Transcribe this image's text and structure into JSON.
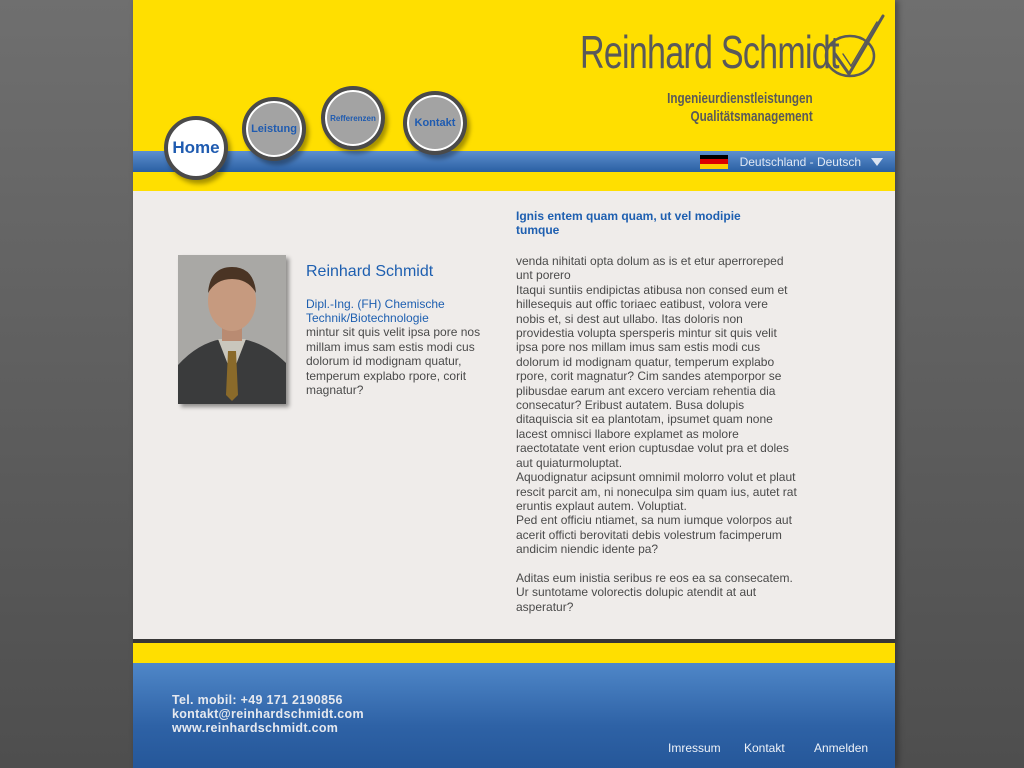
{
  "logo": {
    "name": "Reinhard Schmidt",
    "subtitle_1": "Ingenieurdienstleistungen",
    "subtitle_2": "Qualitätsmanagement"
  },
  "nav": {
    "home": "Home",
    "leistung": "Leistung",
    "referenzen": "Refferenzen",
    "kontakt": "Kontakt"
  },
  "language": {
    "selected": "Deutschland - Deutsch"
  },
  "profile": {
    "name": "Reinhard Schmidt",
    "title": "Dipl.-Ing. (FH) Chemische Technik/Biotechnologie",
    "text": "mintur sit quis velit ipsa pore nos millam imus sam estis modi cus dolorum id modignam quatur, temperum explabo rpore, corit magnatur?"
  },
  "article": {
    "heading": "Ignis entem quam quam, ut vel modipie tumque",
    "paragraphs": [
      "venda nihitati opta dolum as is et etur aperroreped unt porero",
      "Itaqui suntiis endipictas atibusa non consed eum et hillesequis aut offic toriaec eatibust, volora vere nobis et, si dest aut ullabo. Itas doloris non providestia volupta spersperis mintur sit quis velit ipsa pore nos millam imus sam estis modi cus dolorum id modignam quatur, temperum explabo rpore, corit magnatur? Cim sandes atemporpor se plibusdae earum ant excero verciam rehentia dia consecatur? Eribust autatem. Busa dolupis ditaquiscia sit ea plantotam, ipsumet quam none lacest omnisci llabore explamet as molore raectotatate vent erion cuptusdae volut pra et doles aut quiaturmoluptat.",
      "Aquodignatur acipsunt omnimil molorro volut et plaut rescit parcit am, ni noneculpa sim quam ius, autet rat eruntis explaut autem. Voluptiat.",
      "Ped ent officiu ntiamet, sa num iumque volorpos aut acerit officti berovitati debis volestrum facimperum andicim niendic idente pa?",
      "Aditas eum inistia seribus re eos ea sa consecatem. Ur suntotame volorectis dolupic atendit at aut asperatur?"
    ]
  },
  "footer": {
    "phone": "Tel. mobil: +49 171 2190856",
    "email": "kontakt@reinhardschmidt.com",
    "web": "www.reinhardschmidt.com",
    "links": {
      "impressum": "Imressum",
      "kontakt": "Kontakt",
      "anmelden": "Anmelden"
    }
  },
  "colors": {
    "brand_yellow": "#ffdf00",
    "brand_blue": "#1e5fb0",
    "logo_gray": "#59595a"
  },
  "icons": {
    "logo_mark": "checkmark-ellipse-icon",
    "flag": "german-flag-icon",
    "dropdown": "caret-down-icon"
  }
}
